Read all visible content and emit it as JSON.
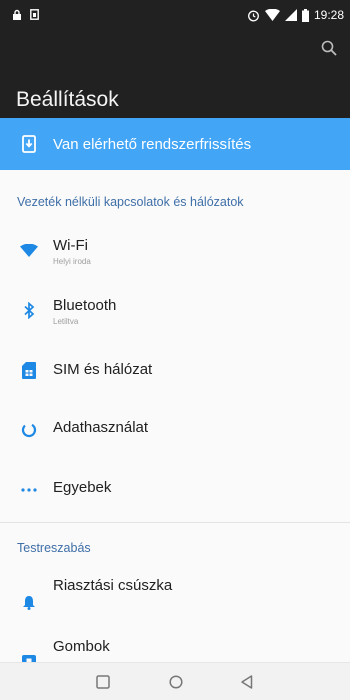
{
  "statusbar": {
    "time": "19:28",
    "icons": [
      "lock-icon",
      "sim-icon",
      "alarm-icon",
      "wifi-icon",
      "signal-icon",
      "battery-icon"
    ]
  },
  "appbar": {
    "title": "Beállítások",
    "search_icon": "search-icon"
  },
  "banner": {
    "text": "Van elérhető rendszerfrissítés",
    "icon": "system-update-icon",
    "color": "#42a5f5"
  },
  "sections": [
    {
      "header": "Vezeték nélküli kapcsolatok és hálózatok",
      "items": [
        {
          "title": "Wi-Fi",
          "subtitle": "Helyi iroda",
          "icon": "wifi-icon"
        },
        {
          "title": "Bluetooth",
          "subtitle": "Letiltva",
          "icon": "bluetooth-icon"
        },
        {
          "title": "SIM és hálózat",
          "icon": "sim-card-icon"
        },
        {
          "title": "Adathasználat",
          "icon": "data-usage-icon"
        },
        {
          "title": "Egyebek",
          "icon": "more-icon"
        }
      ]
    },
    {
      "header": "Testreszabás",
      "items": [
        {
          "title": "Riasztási csúszka",
          "icon": "alert-slider-icon"
        },
        {
          "title": "Gombok",
          "icon": "buttons-icon"
        }
      ]
    }
  ],
  "navbar": {
    "icons": [
      "recents-icon",
      "home-icon",
      "back-icon"
    ]
  },
  "colors": {
    "accent": "#42a5f5",
    "appbar": "#212121",
    "section_header": "#3f6fa8",
    "icon_blue": "#1e88e5"
  }
}
